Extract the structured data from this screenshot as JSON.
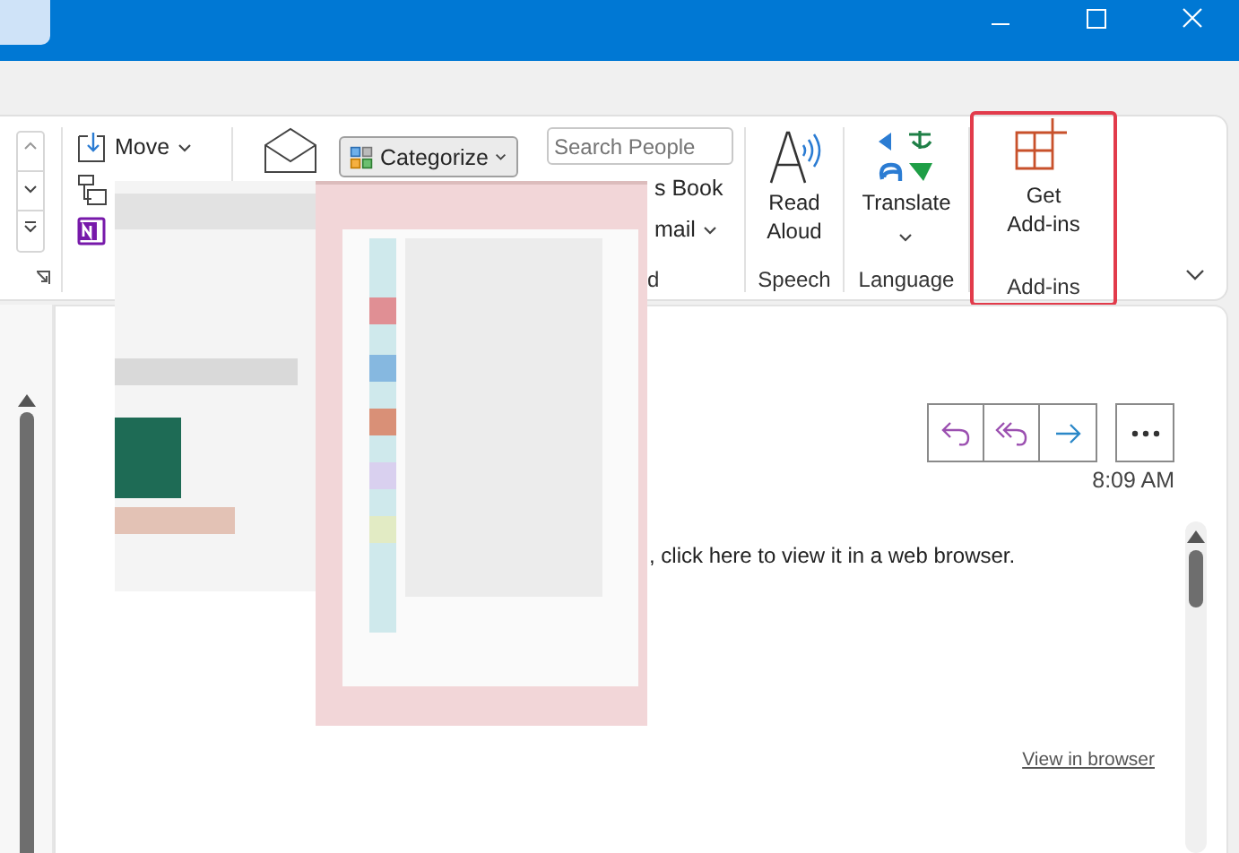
{
  "ribbon": {
    "move_button": {
      "label": "Move"
    },
    "categorize_button": {
      "label": "Categorize"
    },
    "search_field": {
      "placeholder": "Search People"
    },
    "address_book_button": {
      "label": "s Book"
    },
    "filter_email_button": {
      "label": "mail"
    },
    "find_group_label": "d",
    "read_aloud_button": {
      "label": "Read Aloud",
      "group": "Speech"
    },
    "translate_button": {
      "label": "Translate",
      "group": "Language"
    },
    "add_ins_button": {
      "label": "Get Add-ins",
      "group": "Add-ins",
      "highlighted": true
    }
  },
  "message": {
    "time": "8:09 AM",
    "body_fragment": ", click here to view it in a web browser.",
    "view_in_browser": "View in browser"
  }
}
